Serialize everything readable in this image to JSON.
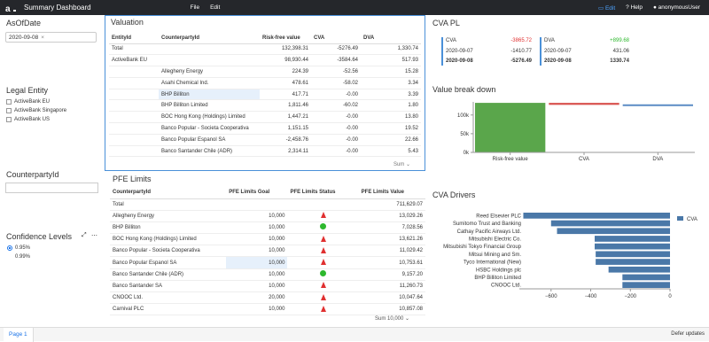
{
  "app": {
    "title": "Summary Dashboard",
    "menu": [
      "File",
      "Edit"
    ],
    "edit_label": "Edit",
    "help_label": "Help",
    "user": "anonymousUser"
  },
  "filters": {
    "asofdate_title": "AsOfDate",
    "asofdate_value": "2020-09-08",
    "legal_entity_title": "Legal Entity",
    "legal_entities": [
      "ActiveBank EU",
      "ActiveBank Singapore",
      "ActiveBank US"
    ],
    "counterparty_title": "CounterpartyId",
    "confidence_title": "Confidence Levels",
    "confidence_levels": [
      "0.95%",
      "0.99%"
    ]
  },
  "valuation": {
    "title": "Valuation",
    "columns": [
      "EntityId",
      "CounterpartyId",
      "Risk-free value",
      "CVA",
      "DVA"
    ],
    "rows": [
      [
        "Total",
        "",
        "132,398.31",
        "-5276.49",
        "1,330.74"
      ],
      [
        "ActiveBank EU",
        "",
        "98,930.44",
        "-3584.64",
        "517.93"
      ],
      [
        "",
        "Allegheny Energy",
        "224.39",
        "-52.56",
        "15.28"
      ],
      [
        "",
        "Asahi Chemical Ind.",
        "478.61",
        "-58.02",
        "3.34"
      ],
      [
        "",
        "BHP Billiton",
        "417.71",
        "-0.00",
        "3.39"
      ],
      [
        "",
        "BHP Billiton Limited",
        "1,811.46",
        "-60.02",
        "1.80"
      ],
      [
        "",
        "BOC Hong Kong (Holdings) Limited",
        "1,447.21",
        "-0.00",
        "13.80"
      ],
      [
        "",
        "Banco Popular - Societa Cooperativa",
        "1,151.15",
        "-0.00",
        "19.52"
      ],
      [
        "",
        "Banco Popular Espanol SA",
        "-2,458.76",
        "-0.00",
        "22.66"
      ],
      [
        "",
        "Banco Santander Chile (ADR)",
        "2,314.11",
        "-0.00",
        "5.43"
      ]
    ],
    "footer": "Sum"
  },
  "cva_pl": {
    "title": "CVA PL",
    "cva": {
      "label": "CVA",
      "delta": "-3865.72",
      "row1_date": "2020-09-07",
      "row1_val": "-1410.77",
      "row2_date": "2020-09-08",
      "row2_val": "-5276.49"
    },
    "dva": {
      "label": "DVA",
      "delta": "+899.68",
      "row1_date": "2020-09-07",
      "row1_val": "431.06",
      "row2_date": "2020-09-08",
      "row2_val": "1330.74"
    },
    "colors": {
      "neg": "#e03030",
      "pos": "#2db82d",
      "accent": "#4a90d9"
    }
  },
  "value_breakdown": {
    "title": "Value break down",
    "y_ticks": [
      "100k",
      "50k",
      "0k"
    ],
    "categories": [
      "Risk-free value",
      "CVA",
      "DVA"
    ]
  },
  "pfe": {
    "title": "PFE Limits",
    "columns": [
      "CounterpartyId",
      "PFE Limits Goal",
      "PFE Limits Status",
      "PFE Limits Value"
    ],
    "rows": [
      {
        "name": "Total",
        "goal": "",
        "status": "",
        "value": "711,629.07"
      },
      {
        "name": "Allegheny Energy",
        "goal": "10,000",
        "status": "red-triangle-icon",
        "value": "13,029.26"
      },
      {
        "name": "BHP Billiton",
        "goal": "10,000",
        "status": "green-dot-icon",
        "value": "7,028.56"
      },
      {
        "name": "BOC Hong Kong (Holdings) Limited",
        "goal": "10,000",
        "status": "red-triangle-icon",
        "value": "13,621.26"
      },
      {
        "name": "Banco Popular - Societa Cooperativa",
        "goal": "10,000",
        "status": "red-triangle-icon",
        "value": "11,029.42"
      },
      {
        "name": "Banco Popular Espanol SA",
        "goal": "10,000",
        "status": "red-triangle-icon",
        "value": "10,753.61"
      },
      {
        "name": "Banco Santander Chile (ADR)",
        "goal": "10,000",
        "status": "green-dot-icon",
        "value": "9,157.20"
      },
      {
        "name": "Banco Santander SA",
        "goal": "10,000",
        "status": "red-triangle-icon",
        "value": "11,260.73"
      },
      {
        "name": "CNOOC Ltd.",
        "goal": "20,000",
        "status": "red-triangle-icon",
        "value": "10,047.64"
      },
      {
        "name": "Carnival PLC",
        "goal": "10,000",
        "status": "red-triangle-icon",
        "value": "10,857.08"
      }
    ],
    "footer": "Sum 10,000"
  },
  "chart_data": [
    {
      "type": "bar",
      "title": "Value break down",
      "categories": [
        "Risk-free value",
        "CVA",
        "DVA"
      ],
      "values": [
        132398.31,
        -5276.49,
        1330.74
      ],
      "colors": [
        "#5aa64b",
        "#d9534f",
        "#5b8cc5"
      ],
      "ylim": [
        0,
        135000
      ],
      "yticks": [
        0,
        50000,
        100000
      ],
      "ytick_labels": [
        "0k",
        "50k",
        "100k"
      ]
    },
    {
      "type": "bar",
      "orientation": "horizontal",
      "title": "CVA Drivers",
      "categories": [
        "Reed Elsevier PLC",
        "Sumitomo Trust and Banking",
        "Cathay Pacific Airways Ltd.",
        "Mitsubishi Electric Co.",
        "Mitsubishi Tokyo Financial Group",
        "Mitsui Mining and Sm.",
        "Tyco International (New)",
        "HSBC Holdings plc",
        "BHP Billiton Limited",
        "CNOOC Ltd."
      ],
      "series": [
        {
          "name": "CVA",
          "values": [
            -740,
            -600,
            -570,
            -380,
            -380,
            -375,
            -375,
            -310,
            -240,
            -240
          ]
        }
      ],
      "xlim": [
        -760,
        0
      ],
      "xticks": [
        -600,
        -400,
        -200,
        0
      ],
      "color": "#4a78a8",
      "legend": "right"
    }
  ]
}
